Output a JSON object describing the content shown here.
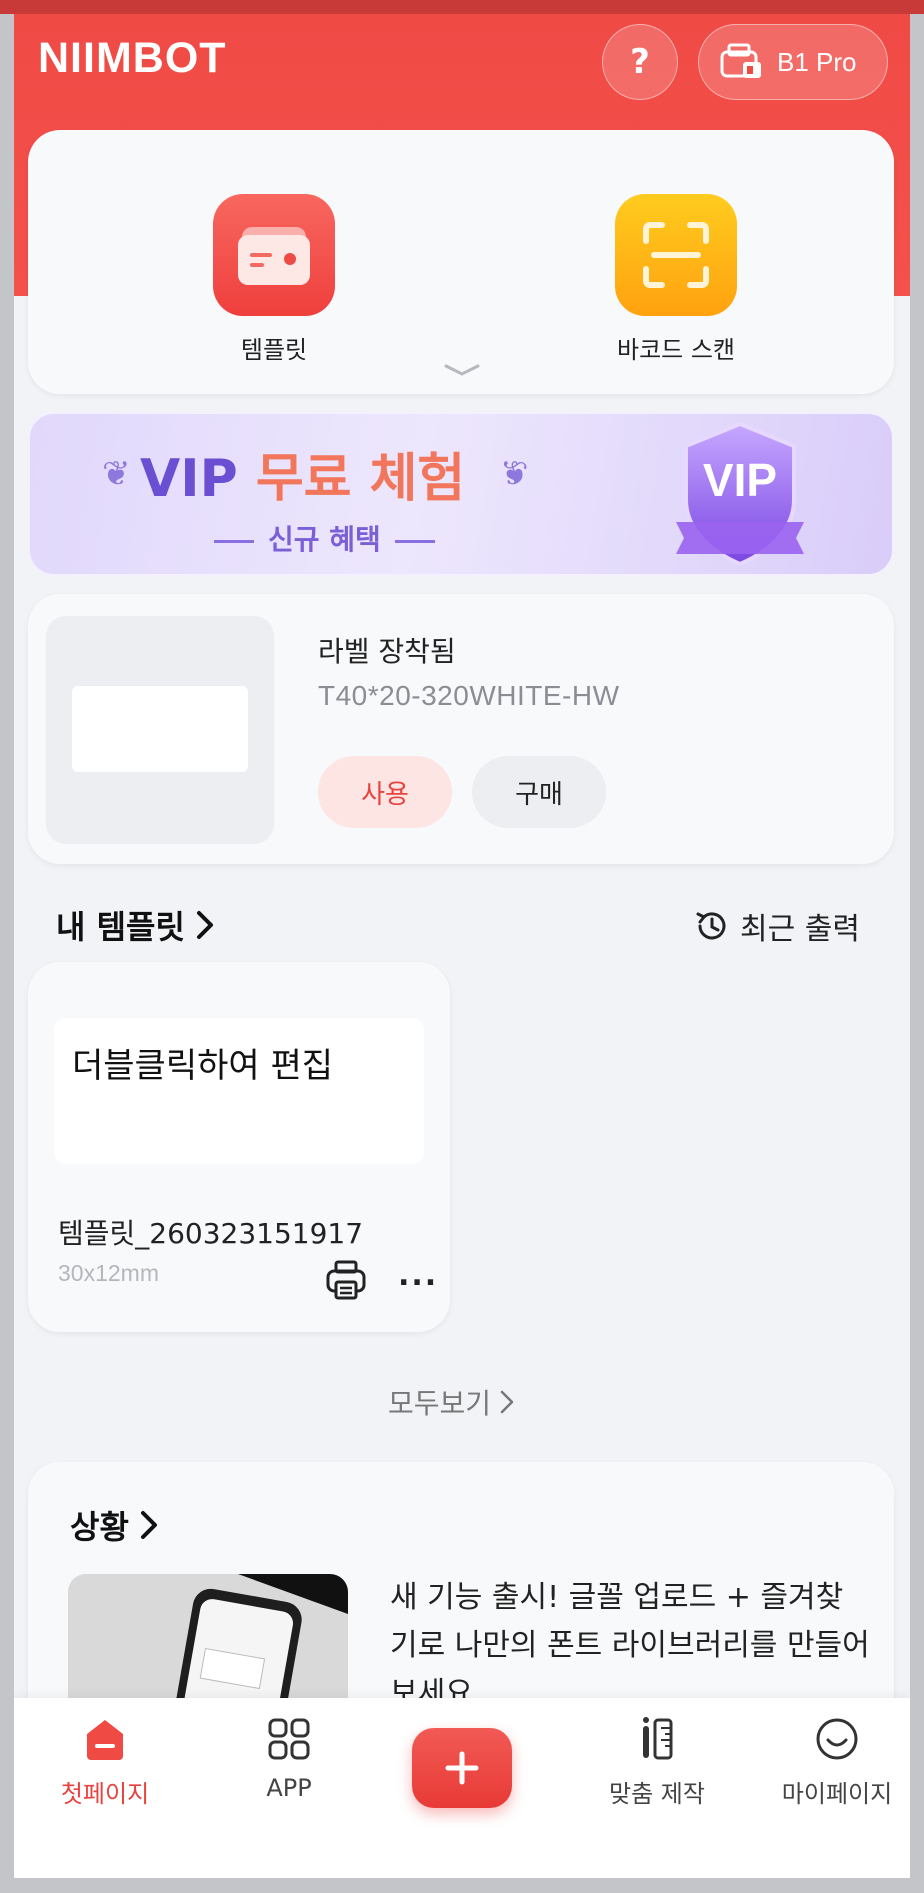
{
  "header": {
    "logo": "NIIMBOT",
    "help_label": "?",
    "device_name": "B1 Pro"
  },
  "quick": {
    "items": [
      {
        "label": "템플릿",
        "icon": "template-icon"
      },
      {
        "label": "바코드 스캔",
        "icon": "barcode-scan-icon"
      }
    ]
  },
  "vip": {
    "title_a": "VIP",
    "title_b": "무료 체험",
    "subtitle": "신규 혜택",
    "badge": "VIP"
  },
  "label": {
    "status": "라벨 장착됨",
    "code": "T40*20-320WHITE-HW",
    "use_button": "사용",
    "buy_button": "구매"
  },
  "templates": {
    "section_title": "내 템플릿",
    "recent_label": "최근 출력",
    "card": {
      "preview_text": "더블클릭하여 편집",
      "name": "템플릿_260323151917",
      "size": "30x12mm",
      "more": "..."
    },
    "view_all": "모두보기"
  },
  "news": {
    "section_title": "상황",
    "text": "새 기능 출시! 글꼴 업로드 + 즐겨찾기로 나만의 폰트 라이브러리를 만들어보세요"
  },
  "tabbar": {
    "items": [
      {
        "label": "첫페이지",
        "icon": "home-icon"
      },
      {
        "label": "APP",
        "icon": "apps-grid-icon"
      },
      {
        "label": "맞춤 제작",
        "icon": "ruler-icon"
      },
      {
        "label": "마이페이지",
        "icon": "smiley-icon"
      }
    ]
  },
  "colors": {
    "brand_red": "#f04a45",
    "vip_purple": "#6a4fd3",
    "vip_orange": "#f2765c"
  }
}
